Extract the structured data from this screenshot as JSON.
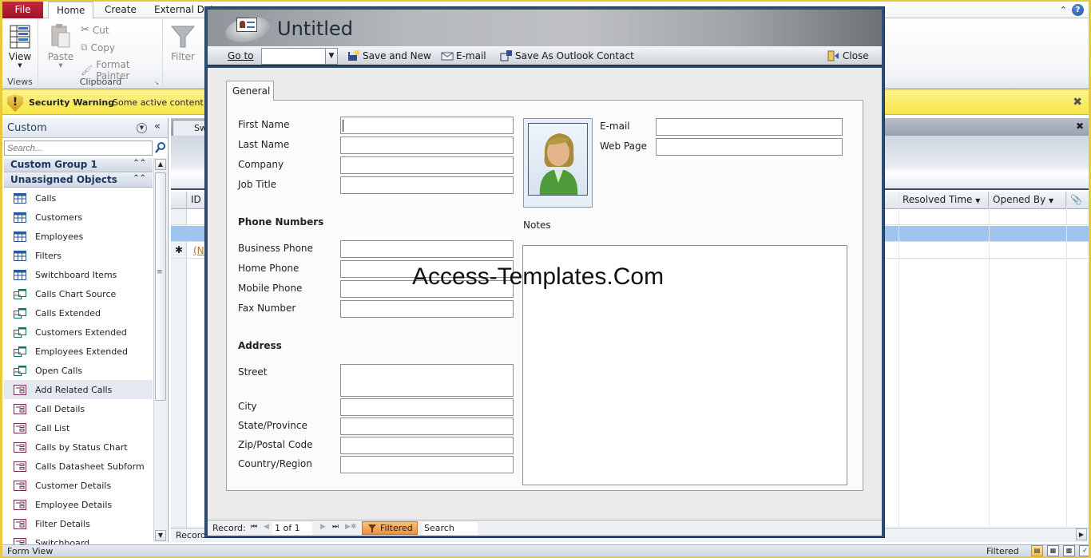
{
  "ribbon": {
    "tabs": [
      "File",
      "Home",
      "Create",
      "External Data"
    ],
    "active_tab": "Home",
    "groups": {
      "views": {
        "label": "Views",
        "view_button": "View"
      },
      "clipboard": {
        "label": "Clipboard",
        "paste": "Paste",
        "cut": "Cut",
        "copy": "Copy",
        "format_painter": "Format Painter"
      },
      "sort_filter": {
        "filter": "Filter"
      }
    }
  },
  "security_bar": {
    "title": "Security Warning",
    "message": "Some active content h"
  },
  "nav_pane": {
    "title": "Custom",
    "search_placeholder": "Search...",
    "groups": [
      {
        "label": "Custom Group 1"
      },
      {
        "label": "Unassigned Objects"
      }
    ],
    "items": [
      {
        "label": "Calls",
        "type": "table"
      },
      {
        "label": "Customers",
        "type": "table"
      },
      {
        "label": "Employees",
        "type": "table"
      },
      {
        "label": "Filters",
        "type": "table"
      },
      {
        "label": "Switchboard Items",
        "type": "table"
      },
      {
        "label": "Calls Chart Source",
        "type": "query"
      },
      {
        "label": "Calls Extended",
        "type": "query"
      },
      {
        "label": "Customers Extended",
        "type": "query"
      },
      {
        "label": "Employees Extended",
        "type": "query"
      },
      {
        "label": "Open Calls",
        "type": "query"
      },
      {
        "label": "Add Related Calls",
        "type": "form",
        "selected": true
      },
      {
        "label": "Call Details",
        "type": "form"
      },
      {
        "label": "Call List",
        "type": "form"
      },
      {
        "label": "Calls by Status Chart",
        "type": "form"
      },
      {
        "label": "Calls Datasheet Subform",
        "type": "form"
      },
      {
        "label": "Customer Details",
        "type": "form"
      },
      {
        "label": "Employee Details",
        "type": "form"
      },
      {
        "label": "Filter Details",
        "type": "form"
      },
      {
        "label": "Switchboard",
        "type": "form"
      }
    ]
  },
  "datasheet": {
    "tab_label": "Sw",
    "columns": [
      "ID",
      "Resolved Time",
      "Opened By"
    ],
    "new_row_marker": "(N",
    "record_label": "Record"
  },
  "popup": {
    "title": "Untitled",
    "toolbar": {
      "goto_label": "Go to",
      "goto_value": "",
      "save_new": "Save and New",
      "email": "E-mail",
      "save_outlook": "Save As Outlook Contact",
      "close": "Close"
    },
    "tab": "General",
    "fields_left": [
      {
        "label": "First Name",
        "value": ""
      },
      {
        "label": "Last Name",
        "value": ""
      },
      {
        "label": "Company",
        "value": ""
      },
      {
        "label": "Job Title",
        "value": ""
      }
    ],
    "phone_section": "Phone Numbers",
    "phone_fields": [
      {
        "label": "Business Phone",
        "value": ""
      },
      {
        "label": "Home Phone",
        "value": ""
      },
      {
        "label": "Mobile Phone",
        "value": ""
      },
      {
        "label": "Fax Number",
        "value": ""
      }
    ],
    "address_section": "Address",
    "address_fields": [
      {
        "label": "Street",
        "value": ""
      },
      {
        "label": "City",
        "value": ""
      },
      {
        "label": "State/Province",
        "value": ""
      },
      {
        "label": "Zip/Postal Code",
        "value": ""
      },
      {
        "label": "Country/Region",
        "value": ""
      }
    ],
    "fields_right": [
      {
        "label": "E-mail",
        "value": ""
      },
      {
        "label": "Web Page",
        "value": ""
      }
    ],
    "notes_label": "Notes",
    "notes_value": "",
    "record_nav": {
      "label": "Record:",
      "position": "1 of 1",
      "filter_status": "Filtered",
      "search": "Search"
    }
  },
  "status_bar": {
    "view": "Form View",
    "filter": "Filtered"
  },
  "watermark": "Access-Templates.Com"
}
